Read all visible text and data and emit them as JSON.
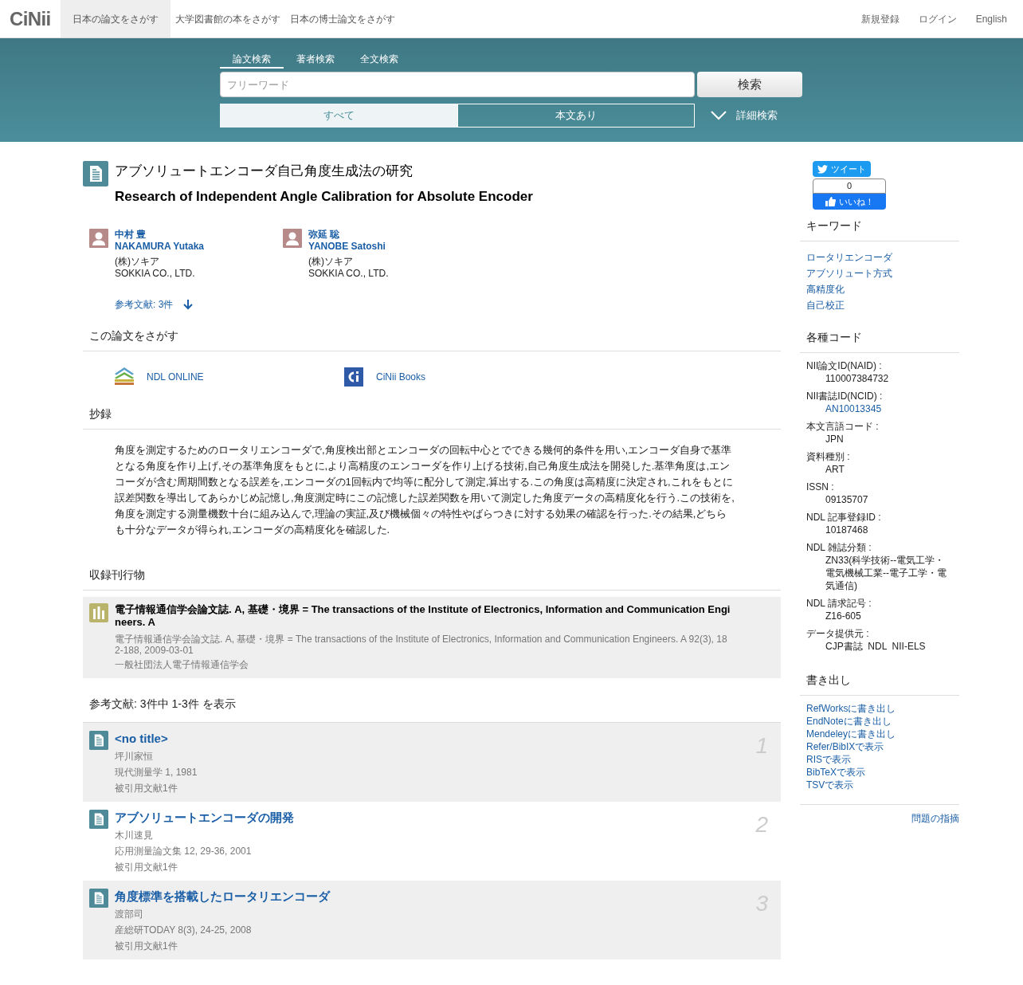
{
  "nav": {
    "logo": "CiNii",
    "tabs": [
      {
        "label": "日本の論文をさがす",
        "selected": true
      },
      {
        "label": "大学図書館の本をさがす",
        "selected": false
      },
      {
        "label": "日本の博士論文をさがす",
        "selected": false
      }
    ],
    "links": [
      "新規登録",
      "ログイン",
      "English"
    ]
  },
  "search": {
    "tabs": [
      {
        "label": "論文検索",
        "selected": true
      },
      {
        "label": "著者検索",
        "selected": false
      },
      {
        "label": "全文検索",
        "selected": false
      }
    ],
    "placeholder": "フリーワード",
    "button": "検索",
    "filters": [
      {
        "label": "すべて",
        "selected": true
      },
      {
        "label": "本文あり",
        "selected": false
      }
    ],
    "advanced": "詳細検索"
  },
  "article": {
    "title_ja": "アブソリュートエンコーダ自己角度生成法の研究",
    "title_en": "Research of Independent Angle Calibration for Absolute Encoder",
    "authors": [
      {
        "name_ja": "中村 豊",
        "name_en": "NAKAMURA Yutaka",
        "affiliation_ja": "(株)ソキア",
        "affiliation_en": "SOKKIA CO., LTD."
      },
      {
        "name_ja": "弥延 聡",
        "name_en": "YANOBE Satoshi",
        "affiliation_ja": "(株)ソキア",
        "affiliation_en": "SOKKIA CO., LTD."
      }
    ],
    "references_link": "参考文献: 3件"
  },
  "find": {
    "heading": "この論文をさがす",
    "links": [
      {
        "kind": "ndl",
        "label": "NDL ONLINE"
      },
      {
        "kind": "cinii",
        "label": "CiNii Books"
      }
    ]
  },
  "abstract": {
    "heading": "抄録",
    "text": "角度を測定するためのロータリエンコーダで,角度検出部とエンコーダの回転中心とでできる幾何的条件を用い,エンコーダ自身で基準となる角度を作り上げ,その基準角度をもとに,より高精度のエンコーダを作り上げる技術,自己角度生成法を開発した.基準角度は,エンコーダが含む周期間数となる誤差を,エンコーダの1回転内で均等に配分して測定,算出する.この角度は高精度に決定され,これをもとに誤差関数を導出してあらかじめ記憶し,角度測定時にこの記憶した誤差関数を用いて測定した角度データの高精度化を行う.この技術を,角度を測定する測量機数十台に組み込んで,理論の実証,及び機械個々の特性やばらつきに対する効果の確認を行った.その結果,どちらも十分なデータが得られ,エンコーダの高精度化を確認した."
  },
  "journal": {
    "heading": "収録刊行物",
    "title": "電子情報通信学会論文誌. A, 基礎・境界 = The transactions of the Institute of Electronics, Information and Communication Engineers. A",
    "detail": "電子情報通信学会論文誌. A, 基礎・境界 = The transactions of the Institute of Electronics, Information and Communication Engineers. A 92(3), 182-188, 2009-03-01",
    "publisher": "一般社団法人電子情報通信学会"
  },
  "references": {
    "heading": "参考文献:  3件中 1-3件 を表示",
    "items": [
      {
        "title": "<no title>",
        "author": "坪川家恒",
        "source": "現代測量学 1, 1981",
        "cited": "被引用文献1件",
        "number": "1"
      },
      {
        "title": "アブソリュートエンコーダの開発",
        "author": "木川速見",
        "source": "応用測量論文集 12, 29-36, 2001",
        "cited": "被引用文献1件",
        "number": "2"
      },
      {
        "title": "角度標準を搭載したロータリエンコーダ",
        "author": "渡部司",
        "source": "産総研TODAY 8(3), 24-25, 2008",
        "cited": "被引用文献1件",
        "number": "3"
      }
    ]
  },
  "sidebar": {
    "tweet": "ツイート",
    "like_count": "0",
    "like": "いいね！",
    "keywords": {
      "heading": "キーワード",
      "items": [
        "ロータリエンコーダ",
        "アブソリュート方式",
        "高精度化",
        "自己校正"
      ]
    },
    "codes": {
      "heading": "各種コード",
      "items": [
        {
          "label": "NII論文ID(NAID) :",
          "value": "110007384732",
          "kind": "text"
        },
        {
          "label": "NII書誌ID(NCID) :",
          "value": "AN10013345",
          "kind": "link"
        },
        {
          "label": "本文言語コード :",
          "value": "JPN",
          "kind": "text"
        },
        {
          "label": "資料種別 :",
          "value": "ART",
          "kind": "text"
        },
        {
          "label": "ISSN :",
          "value": "09135707",
          "kind": "text"
        },
        {
          "label": "NDL 記事登録ID :",
          "value": "10187468",
          "kind": "text"
        },
        {
          "label": "NDL 雑誌分類 :",
          "value": "ZN33(科学技術--電気工学・電気機械工業--電子工学・電気通信)",
          "kind": "text"
        },
        {
          "label": "NDL 請求記号 :",
          "value": "Z16-605",
          "kind": "text"
        },
        {
          "label": "データ提供元 :",
          "value": "CJP書誌  NDL  NII-ELS",
          "kind": "text"
        }
      ]
    },
    "export": {
      "heading": "書き出し",
      "items": [
        "RefWorksに書き出し",
        "EndNoteに書き出し",
        "Mendeleyに書き出し",
        "Refer/BibIXで表示",
        "RISで表示",
        "BibTeXで表示",
        "TSVで表示"
      ]
    },
    "report": "問題の指摘"
  }
}
